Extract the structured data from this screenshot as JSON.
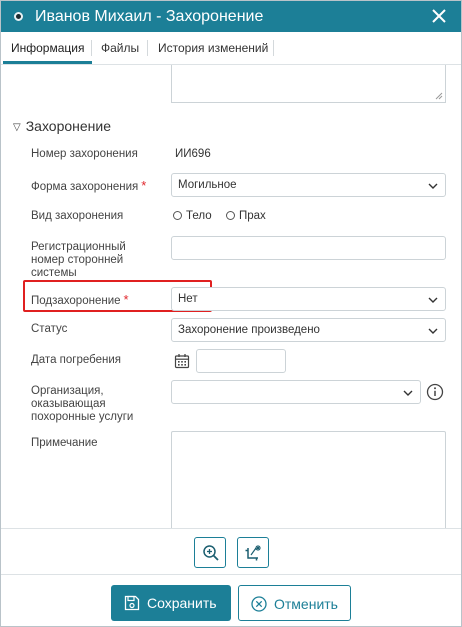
{
  "window": {
    "title": "Иванов Михаил - Захоронение",
    "accent": "#1c7f97"
  },
  "tabs": [
    {
      "label": "Информация",
      "active": true
    },
    {
      "label": "Файлы",
      "active": false
    },
    {
      "label": "История изменений",
      "active": false
    }
  ],
  "section": {
    "title": "Захоронение"
  },
  "fields": {
    "burial_number": {
      "label": "Номер захоронения",
      "value": "ИИ696"
    },
    "burial_form": {
      "label": "Форма захоронения",
      "required": "*",
      "value": "Могильное"
    },
    "burial_kind": {
      "label": "Вид захоронения",
      "options": [
        "Тело",
        "Прах"
      ]
    },
    "reg_number": {
      "label": "Регистрационный номер сторонней системы",
      "value": ""
    },
    "sub_burial": {
      "label": "Подзахоронение",
      "required": "*",
      "value": "Нет"
    },
    "status": {
      "label": "Статус",
      "value": "Захоронение произведено"
    },
    "burial_date": {
      "label": "Дата погребения",
      "value": ""
    },
    "organization": {
      "label": "Организация, оказывающая похоронные услуги",
      "value": ""
    },
    "note": {
      "label": "Примечание",
      "value": ""
    }
  },
  "tools": {
    "zoom_icon": "zoom-in-icon",
    "crop_icon": "crop-icon"
  },
  "footer": {
    "save_label": "Сохранить",
    "cancel_label": "Отменить"
  }
}
